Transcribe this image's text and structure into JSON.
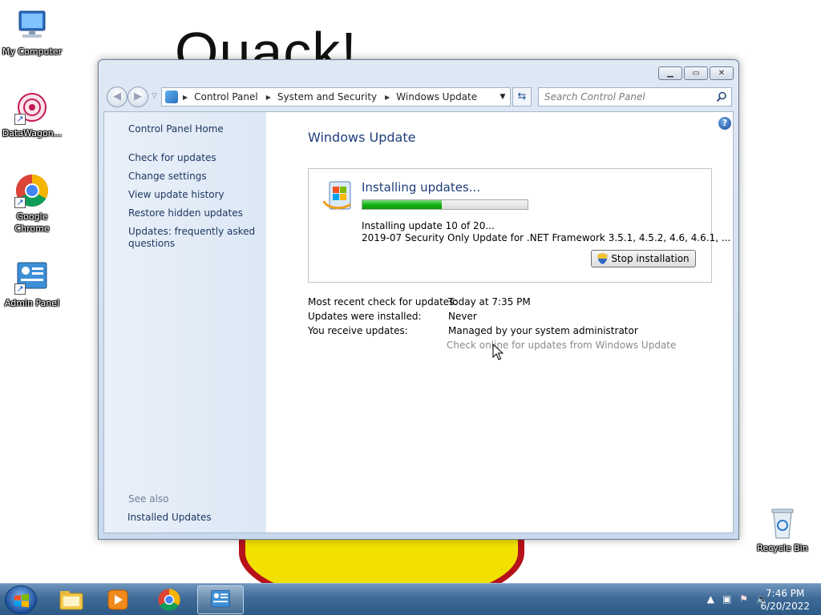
{
  "wallpaper": {
    "text": "Quack!"
  },
  "desktop_icons": [
    {
      "label": "My Computer"
    },
    {
      "label": "DataWagon..."
    },
    {
      "label": "Google Chrome"
    },
    {
      "label": "Admin Panel"
    },
    {
      "label": "Recycle Bin"
    }
  ],
  "address_bar": {
    "crumbs": [
      "Control Panel",
      "System and Security",
      "Windows Update"
    ]
  },
  "search": {
    "placeholder": "Search Control Panel"
  },
  "sidebar": {
    "home": "Control Panel Home",
    "items": [
      {
        "label": "Check for updates"
      },
      {
        "label": "Change settings"
      },
      {
        "label": "View update history"
      },
      {
        "label": "Restore hidden updates"
      },
      {
        "label": "Updates: frequently asked questions"
      }
    ],
    "see_also": "See also",
    "installed_updates": "Installed Updates"
  },
  "main": {
    "title": "Windows Update",
    "status": {
      "title": "Installing updates...",
      "progress_fraction": 0.48,
      "line1": "Installing update 10 of 20...",
      "line2": "2019-07 Security Only Update for .NET Framework 3.5.1, 4.5.2, 4.6, 4.6.1, ...",
      "stop_button": "Stop installation"
    },
    "info": [
      {
        "label": "Most recent check for updates:",
        "value": "Today at 7:35 PM"
      },
      {
        "label": "Updates were installed:",
        "value": "Never"
      },
      {
        "label": "You receive updates:",
        "value": "Managed by your system administrator"
      }
    ],
    "check_online": "Check online for updates from Windows Update"
  },
  "taskbar": {
    "time": "7:46 PM",
    "date": "6/20/2022"
  },
  "colors": {
    "progress": "#17b317",
    "title_blue": "#1e3d7a",
    "link_blue": "#1e3660"
  }
}
